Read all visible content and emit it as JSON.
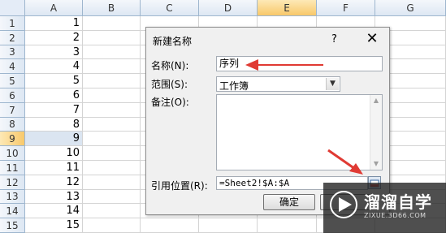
{
  "spreadsheet": {
    "columns": [
      "A",
      "B",
      "C",
      "D",
      "E",
      "F",
      "G"
    ],
    "selected_column": "E",
    "rows": [
      {
        "num": "1",
        "a": "1"
      },
      {
        "num": "2",
        "a": "2"
      },
      {
        "num": "3",
        "a": "3"
      },
      {
        "num": "4",
        "a": "4"
      },
      {
        "num": "5",
        "a": "5"
      },
      {
        "num": "6",
        "a": "6"
      },
      {
        "num": "7",
        "a": "7"
      },
      {
        "num": "8",
        "a": "8"
      },
      {
        "num": "9",
        "a": "9"
      },
      {
        "num": "10",
        "a": "10"
      },
      {
        "num": "11",
        "a": "11"
      },
      {
        "num": "12",
        "a": "12"
      },
      {
        "num": "13",
        "a": "13"
      },
      {
        "num": "14",
        "a": "14"
      },
      {
        "num": "15",
        "a": "15"
      }
    ],
    "selected_row": "9"
  },
  "dialog": {
    "title": "新建名称",
    "help": "?",
    "close": "✕",
    "name_label": "名称(N):",
    "name_value": "序列",
    "scope_label": "范围(S):",
    "scope_value": "工作簿",
    "comment_label": "备注(O):",
    "comment_value": "",
    "refers_label": "引用位置(R):",
    "refers_value": "=Sheet2!$A:$A",
    "ok_label": "确定"
  },
  "watermark": {
    "title": "溜溜自学",
    "subtitle": "ZIXUE.3D66.COM"
  },
  "colors": {
    "arrow": "#e03a33",
    "header_selected": "#f8c86a",
    "grid": "#d4d4d4"
  }
}
